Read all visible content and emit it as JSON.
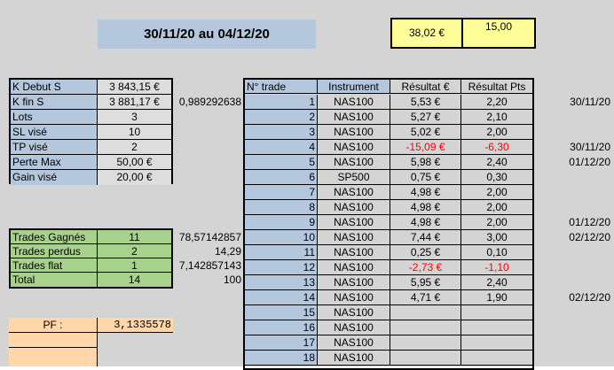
{
  "title": "30/11/20 au 04/12/20",
  "top_boxes": {
    "amount": "38,02 €",
    "points": "15,00"
  },
  "capital": [
    {
      "label": "K Debut S",
      "value": "3 843,15 €"
    },
    {
      "label": "K fin S",
      "value": "3 881,17 €",
      "extra": "0,989292638"
    },
    {
      "label": "Lots",
      "value": "3"
    },
    {
      "label": "SL visé",
      "value": "10"
    },
    {
      "label": "TP visé",
      "value": "2"
    },
    {
      "label": "Perte Max",
      "value": "50,00 €"
    },
    {
      "label": "Gain visé",
      "value": "20,00 €"
    }
  ],
  "stats": [
    {
      "label": "Trades Gagnés",
      "value": "11",
      "extra": "78,57142857"
    },
    {
      "label": "Trades perdus",
      "value": "2",
      "extra": "14,29"
    },
    {
      "label": "Trades flat",
      "value": "1",
      "extra": "7,142857143"
    },
    {
      "label": "Total",
      "value": "14",
      "extra": "100"
    }
  ],
  "pf": {
    "label": "PF :",
    "value": "3,1335578"
  },
  "table": {
    "headers": [
      "N° trade",
      "Instrument",
      "Résultat €",
      "Résultat Pts"
    ],
    "rows": [
      {
        "n": "1",
        "inst": "NAS100",
        "eur": "5,53 €",
        "pts": "2,20",
        "date": "30/11/20",
        "neg": false
      },
      {
        "n": "2",
        "inst": "NAS100",
        "eur": "5,27 €",
        "pts": "2,10",
        "date": "",
        "neg": false
      },
      {
        "n": "3",
        "inst": "NAS100",
        "eur": "5,02 €",
        "pts": "2,00",
        "date": "",
        "neg": false
      },
      {
        "n": "4",
        "inst": "NAS100",
        "eur": "-15,09 €",
        "pts": "-6,30",
        "date": "30/11/20",
        "neg": true
      },
      {
        "n": "5",
        "inst": "NAS100",
        "eur": "5,98 €",
        "pts": "2,40",
        "date": "01/12/20",
        "neg": false
      },
      {
        "n": "6",
        "inst": "SP500",
        "eur": "0,75 €",
        "pts": "0,30",
        "date": "",
        "neg": false
      },
      {
        "n": "7",
        "inst": "NAS100",
        "eur": "4,98 €",
        "pts": "2,00",
        "date": "",
        "neg": false
      },
      {
        "n": "8",
        "inst": "NAS100",
        "eur": "4,98 €",
        "pts": "2,00",
        "date": "",
        "neg": false
      },
      {
        "n": "9",
        "inst": "NAS100",
        "eur": "4,98 €",
        "pts": "2,00",
        "date": "01/12/20",
        "neg": false
      },
      {
        "n": "10",
        "inst": "NAS100",
        "eur": "7,44 €",
        "pts": "3,00",
        "date": "02/12/20",
        "neg": false
      },
      {
        "n": "11",
        "inst": "NAS100",
        "eur": "0,25 €",
        "pts": "0,10",
        "date": "",
        "neg": false
      },
      {
        "n": "12",
        "inst": "NAS100",
        "eur": "-2,73 €",
        "pts": "-1,10",
        "date": "",
        "neg": true
      },
      {
        "n": "13",
        "inst": "NAS100",
        "eur": "5,95 €",
        "pts": "2,40",
        "date": "",
        "neg": false
      },
      {
        "n": "14",
        "inst": "NAS100",
        "eur": "4,71 €",
        "pts": "1,90",
        "date": "02/12/20",
        "neg": false
      },
      {
        "n": "15",
        "inst": "NAS100",
        "eur": "",
        "pts": "",
        "date": "",
        "neg": false
      },
      {
        "n": "16",
        "inst": "NAS100",
        "eur": "",
        "pts": "",
        "date": "",
        "neg": false
      },
      {
        "n": "17",
        "inst": "NAS100",
        "eur": "",
        "pts": "",
        "date": "",
        "neg": false
      },
      {
        "n": "18",
        "inst": "NAS100",
        "eur": "",
        "pts": "",
        "date": "",
        "neg": false
      }
    ]
  }
}
